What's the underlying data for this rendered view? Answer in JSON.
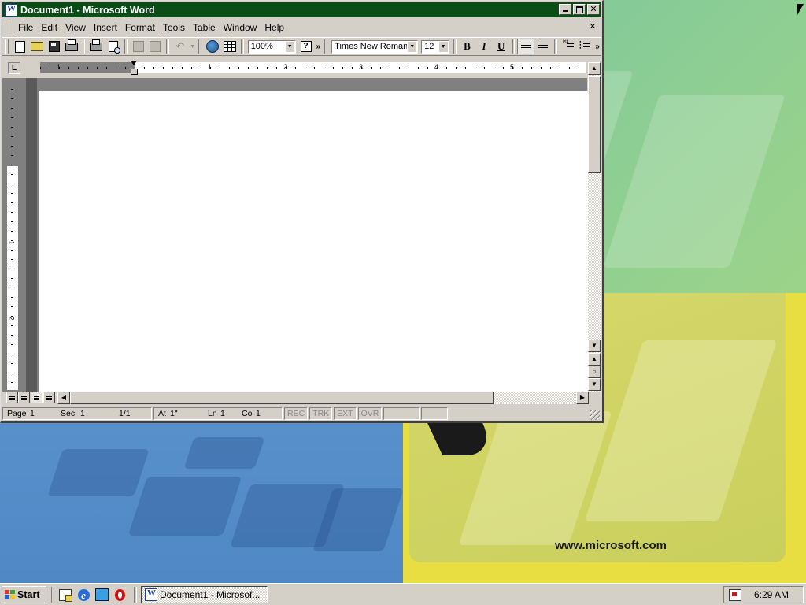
{
  "window": {
    "title": "Document1 - Microsoft Word",
    "close_glyph": "✕",
    "title_bar_color": "#0b4d17"
  },
  "menu": {
    "items": [
      {
        "label": "File",
        "underline": "F",
        "rest": "ile"
      },
      {
        "label": "Edit",
        "underline": "E",
        "rest": "dit"
      },
      {
        "label": "View",
        "underline": "V",
        "rest": "iew"
      },
      {
        "label": "Insert",
        "underline": "I",
        "rest": "nsert"
      },
      {
        "label": "Format",
        "underline": "F",
        "rest": "ormat"
      },
      {
        "label": "Tools",
        "underline": "T",
        "rest": "ools"
      },
      {
        "label": "Table",
        "underline": "T",
        "rest": "able"
      },
      {
        "label": "Window",
        "underline": "W",
        "rest": "indow"
      },
      {
        "label": "Help",
        "underline": "H",
        "rest": "elp"
      }
    ],
    "doc_close_glyph": "✕"
  },
  "toolbar": {
    "zoom": "100%",
    "font_name": "Times New Roman",
    "font_size": "12",
    "more_glyph": "»",
    "bold_label": "B",
    "italic_label": "I",
    "underline_label": "U",
    "icons": [
      "new-document-icon",
      "open-folder-icon",
      "save-icon",
      "print-icon",
      "print-preview-icon",
      "copy-icon",
      "paste-icon",
      "undo-icon",
      "web-toolbar-icon",
      "insert-table-icon",
      "help-icon",
      "align-left-icon",
      "align-center-icon",
      "numbering-icon",
      "bullets-icon"
    ]
  },
  "ruler": {
    "tab_selector": "L",
    "h_labels": [
      "1",
      "1",
      "2",
      "3",
      "4",
      "5"
    ],
    "v_labels": [
      "1",
      "2"
    ]
  },
  "status": {
    "page": "Page",
    "page_num": "1",
    "sec": "Sec",
    "sec_num": "1",
    "page_of": "1/1",
    "at": "At",
    "at_val": "1\"",
    "ln": "Ln",
    "ln_val": "1",
    "col": "Col",
    "col_val": "1",
    "rec": "REC",
    "trk": "TRK",
    "ext": "EXT",
    "ovr": "OVR"
  },
  "wallpaper": {
    "url_text": "www.microsoft.com"
  },
  "taskbar": {
    "start_label": "Start",
    "task_button_label": "Document1 - Microsof...",
    "clock": "6:29 AM",
    "quick_launch_icons": [
      "show-desktop-icon",
      "internet-explorer-icon",
      "channel-icon",
      "opera-icon"
    ]
  }
}
